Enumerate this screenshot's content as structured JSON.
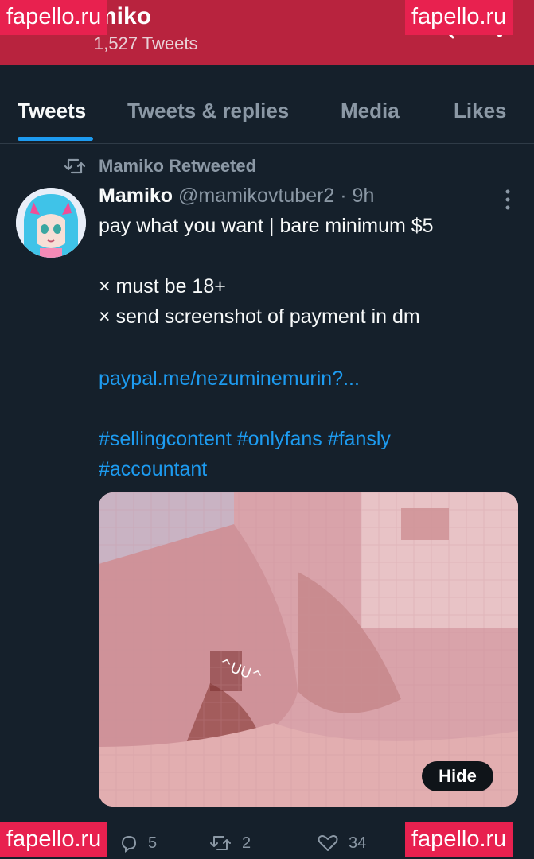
{
  "header": {
    "name": "miko",
    "tweet_count": "1,527 Tweets",
    "background": "#b8233e",
    "icons": [
      "search-icon",
      "more-icon"
    ]
  },
  "watermark": {
    "text": "fapello.ru",
    "color": "#e8214f"
  },
  "tabs": [
    {
      "label": "Tweets",
      "active": true
    },
    {
      "label": "Tweets & replies",
      "active": false
    },
    {
      "label": "Media",
      "active": false
    },
    {
      "label": "Likes",
      "active": false
    }
  ],
  "tweet": {
    "retweet_label": "Mamiko Retweeted",
    "author_name": "Mamiko",
    "handle_time": "@mamikovtuber2 · 9h",
    "lines": {
      "l1": "pay what you want | bare minimum $5",
      "l2": "× must be 18+",
      "l3": "× send screenshot of payment in dm",
      "link": "paypal.me/nezuminemurin?...",
      "tags1": "#sellingcontent #onlyfans #fansly",
      "tags2": "#accountant"
    },
    "media_overlay_text": "^UU^",
    "hide_label": "Hide",
    "actions": {
      "replies": "5",
      "retweets": "2",
      "likes": "34"
    }
  },
  "colors": {
    "background": "#15202b",
    "accent": "#1d9bf0",
    "muted": "#8b98a5"
  }
}
